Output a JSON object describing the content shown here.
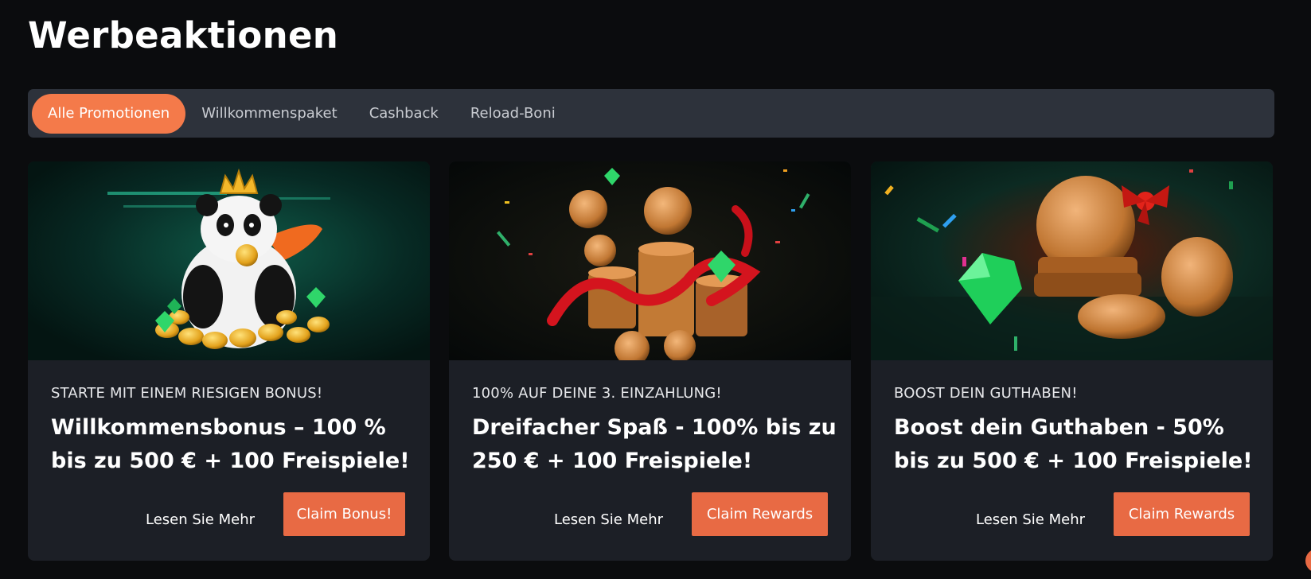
{
  "page": {
    "title": "Werbeaktionen"
  },
  "tabs": [
    {
      "label": "Alle Promotionen",
      "active": true
    },
    {
      "label": "Willkommenspaket",
      "active": false
    },
    {
      "label": "Cashback",
      "active": false
    },
    {
      "label": "Reload-Boni",
      "active": false
    }
  ],
  "cards": [
    {
      "subtitle": "STARTE MIT EINEM RIESIGEN BONUS!",
      "title": "Willkommensbonus – 100 % bis zu 500 € + 100 Freispiele!",
      "read_more": "Lesen Sie Mehr",
      "cta": "Claim Bonus!",
      "image": "panda-with-coins-illustration"
    },
    {
      "subtitle": "100% AUF DEINE 3. EINZAHLUNG!",
      "title": "Dreifacher Spaß - 100% bis zu 250 € + 100 Freispiele!",
      "read_more": "Lesen Sie Mehr",
      "cta": "Claim Rewards",
      "image": "coin-stacks-ribbon-illustration"
    },
    {
      "subtitle": "BOOST DEIN GUTHABEN!",
      "title": "Boost dein Guthaben - 50% bis zu 500 € + 100 Freispiele!",
      "read_more": "Lesen Sie Mehr",
      "cta": "Claim Rewards",
      "image": "coins-with-bow-gem-illustration"
    }
  ],
  "colors": {
    "accent": "#f47a4a",
    "button": "#e86a44",
    "card_bg": "#1c1f26",
    "tabbar_bg": "#2d323b",
    "page_bg": "#0b0c0e"
  }
}
